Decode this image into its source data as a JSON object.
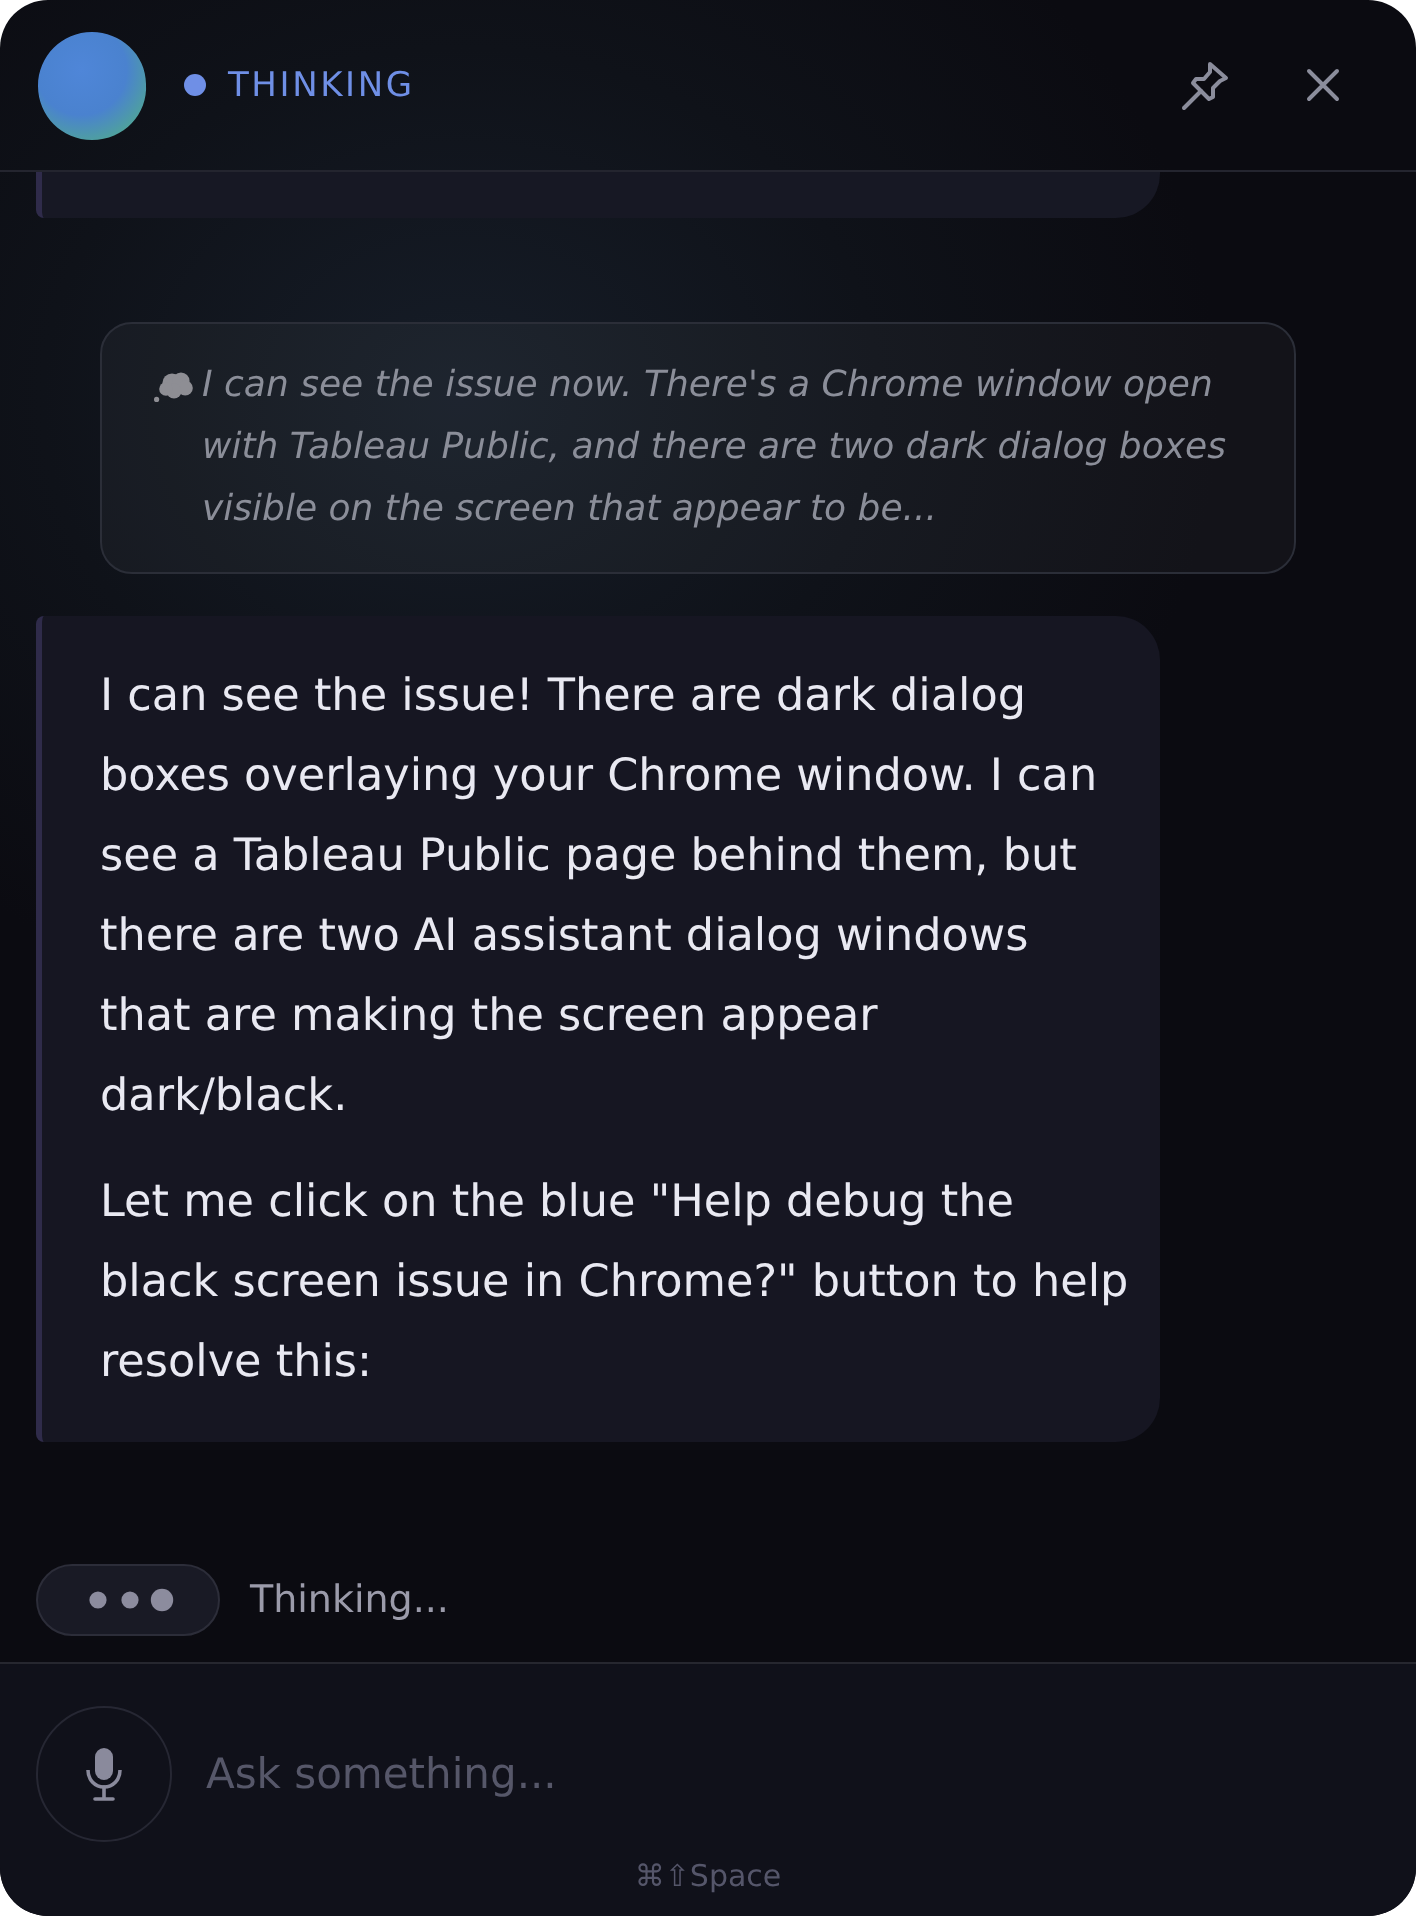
{
  "header": {
    "status": "THINKING"
  },
  "conversation": [
    {
      "kind": "cutoff"
    },
    {
      "kind": "thought",
      "text": "I can see the issue now. There's a Chrome window open with Tableau Public, and there are two dark dialog boxes visible on the screen that appear to be..."
    },
    {
      "kind": "reply",
      "paragraphs": [
        "I can see the issue! There are dark dialog boxes overlaying your Chrome window. I can see a Tableau Public page behind them, but there are two AI assistant dialog windows that are making the screen appear dark/black.",
        "Let me click on the blue \"Help debug the black screen issue in Chrome?\" button to help resolve this:"
      ]
    }
  ],
  "activity": {
    "label": "Thinking..."
  },
  "composer": {
    "placeholder": "Ask something...",
    "shortcut": "⌘⇧Space"
  }
}
